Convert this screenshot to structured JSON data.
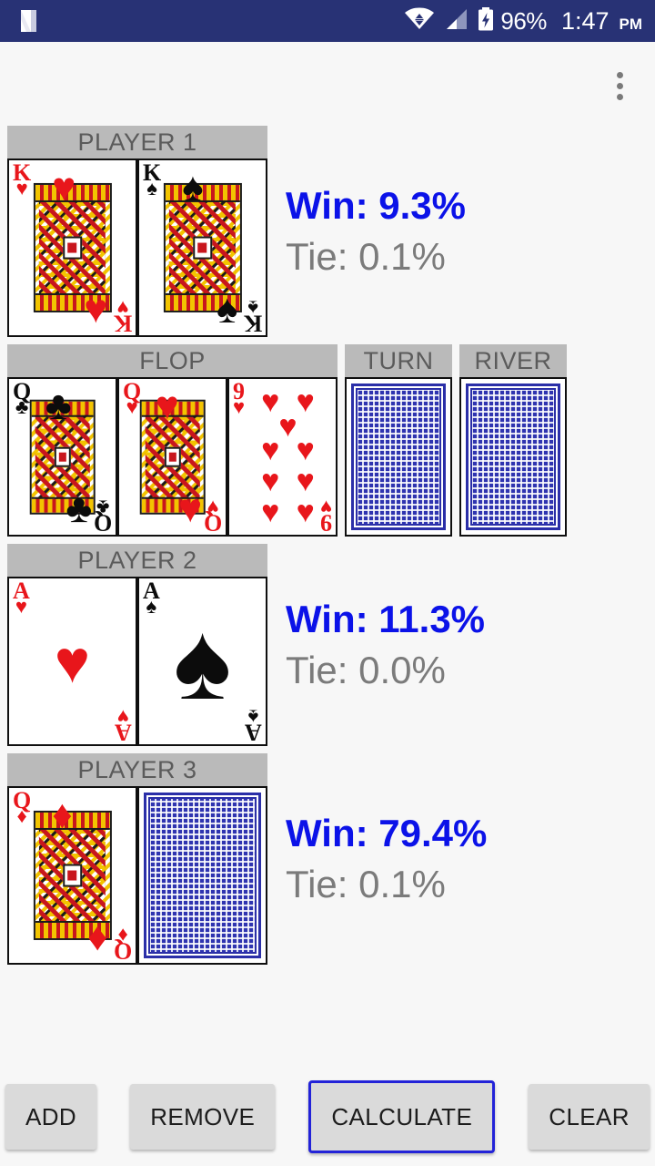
{
  "status_bar": {
    "app_icon": "android-n-logo-icon",
    "wifi_icon": "wifi-transfer-icon",
    "signal_icon": "cell-signal-icon",
    "battery_icon": "battery-charging-icon",
    "battery_percent": "96%",
    "time": "1:47",
    "am_pm": "PM",
    "background_color": "#283275"
  },
  "action_bar": {
    "overflow_icon": "overflow-menu-icon"
  },
  "colors": {
    "win_text": "#0b12e8",
    "tie_text": "#7b7b7b",
    "label_bar": "#bababa",
    "page_background": "#f7f7f7",
    "button_face": "#dadada",
    "focus_outline": "#2323d8",
    "card_back": "#2f34b0"
  },
  "players": [
    {
      "label": "PLAYER 1",
      "cards": [
        {
          "rank": "K",
          "suit": "♥",
          "color": "red",
          "type": "face",
          "name": "king-of-hearts"
        },
        {
          "rank": "K",
          "suit": "♠",
          "color": "black",
          "type": "face",
          "name": "king-of-spades"
        }
      ],
      "win_label": "Win: 9.3%",
      "tie_label": "Tie: 0.1%",
      "win_value": 9.3,
      "tie_value": 0.1
    },
    {
      "label": "PLAYER 2",
      "cards": [
        {
          "rank": "A",
          "suit": "♥",
          "color": "red",
          "type": "ace",
          "name": "ace-of-hearts"
        },
        {
          "rank": "A",
          "suit": "♠",
          "color": "black",
          "type": "ace",
          "name": "ace-of-spades"
        }
      ],
      "win_label": "Win: 11.3%",
      "tie_label": "Tie: 0.0%",
      "win_value": 11.3,
      "tie_value": 0.0
    },
    {
      "label": "PLAYER 3",
      "cards": [
        {
          "rank": "Q",
          "suit": "♦",
          "color": "red",
          "type": "face",
          "name": "queen-of-diamonds"
        },
        {
          "rank": "",
          "suit": "",
          "color": "",
          "type": "back",
          "name": "face-down-card"
        }
      ],
      "win_label": "Win: 79.4%",
      "tie_label": "Tie: 0.1%",
      "win_value": 79.4,
      "tie_value": 0.1
    }
  ],
  "board": {
    "flop": {
      "label": "FLOP",
      "cards": [
        {
          "rank": "Q",
          "suit": "♣",
          "color": "black",
          "type": "face",
          "name": "queen-of-clubs"
        },
        {
          "rank": "Q",
          "suit": "♥",
          "color": "red",
          "type": "face",
          "name": "queen-of-hearts"
        },
        {
          "rank": "9",
          "suit": "♥",
          "color": "red",
          "type": "pips",
          "pip_count": 9,
          "name": "nine-of-hearts"
        }
      ]
    },
    "turn": {
      "label": "TURN",
      "cards": [
        {
          "type": "back",
          "name": "face-down-card"
        }
      ]
    },
    "river": {
      "label": "RIVER",
      "cards": [
        {
          "type": "back",
          "name": "face-down-card"
        }
      ]
    }
  },
  "buttons": [
    {
      "label": "ADD",
      "name": "add-button",
      "focused": false
    },
    {
      "label": "REMOVE",
      "name": "remove-button",
      "focused": false
    },
    {
      "label": "CALCULATE",
      "name": "calculate-button",
      "focused": true
    },
    {
      "label": "CLEAR",
      "name": "clear-button",
      "focused": false
    }
  ]
}
